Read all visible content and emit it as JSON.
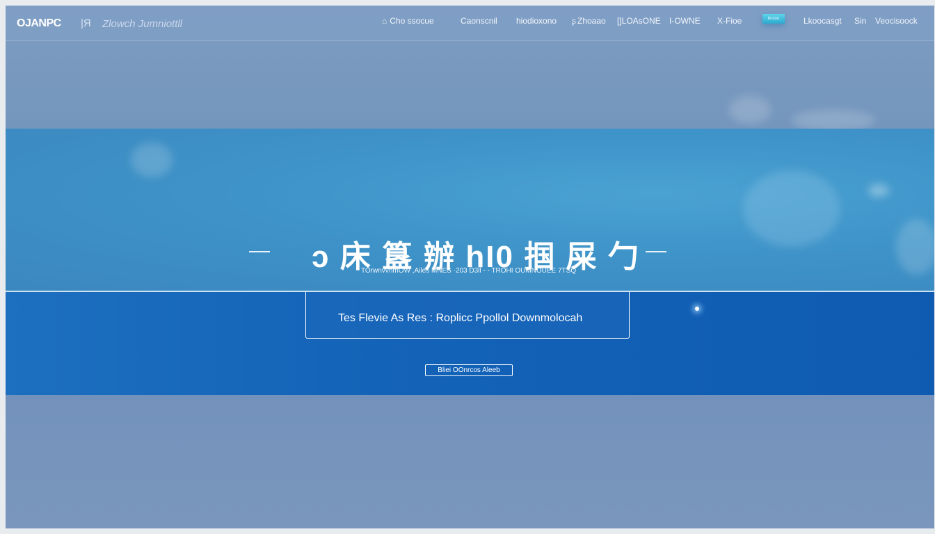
{
  "header": {
    "logo": "OJANPC",
    "logo_separator": "|Я",
    "logo_subtitle": "Zlowch Jumniottll"
  },
  "nav": {
    "items": [
      {
        "label": "Cho ssocue",
        "icon": "home-icon"
      },
      {
        "label": "Caonscnil"
      },
      {
        "label": "hiodioxono"
      },
      {
        "label": "Zhoaao",
        "icon": "user-icon"
      },
      {
        "label": "[]LOAsONE"
      },
      {
        "label": "I-OWNE"
      },
      {
        "label": "X-Fioe"
      },
      {
        "label": "Lkoocasgt"
      },
      {
        "label": "Sin"
      },
      {
        "label": "Veocisoock"
      }
    ],
    "accent_button_label": "bosou"
  },
  "hero": {
    "title": "ɔ 床 簋 辦 hΙ0 掴 屎 勹",
    "subtitle": "TOrwnvvnmOW ,Ailes  MNES  ·203  D3ll  - -  TROHI OUMNOUEE  7TSQ"
  },
  "search": {
    "text": "Tes  Flevie  As Res :  Roplicc  Ppollol  Downmolocah"
  },
  "band": {
    "button_label": "Bliei OOnrcos  Aleeb"
  },
  "colors": {
    "hero_blue": "#3e93c8",
    "band_blue": "#1363b8",
    "accent_cyan": "#3fbde0"
  }
}
